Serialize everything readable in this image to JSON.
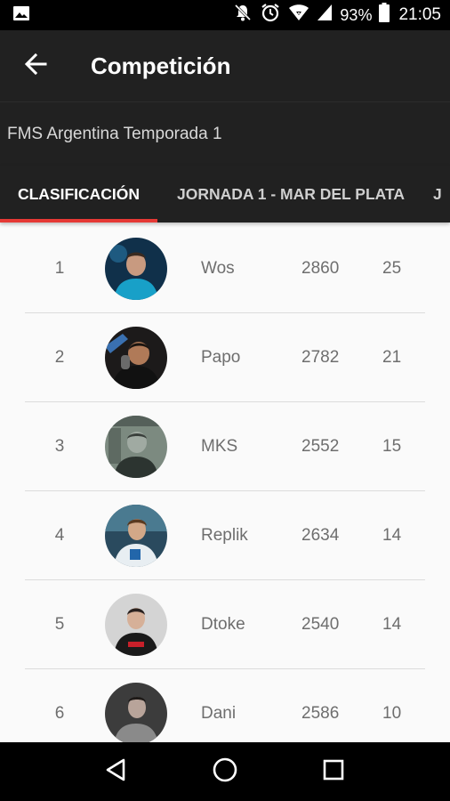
{
  "status_bar": {
    "battery": "93%",
    "time": "21:05",
    "icons": [
      "image-icon",
      "notifications-off-icon",
      "alarm-icon",
      "wifi-icon",
      "cellular-signal-icon",
      "battery-icon"
    ]
  },
  "app_bar": {
    "title": "Competición",
    "back_icon": "arrow-back-icon"
  },
  "competition": {
    "name": "FMS Argentina Temporada 1"
  },
  "tabs": [
    {
      "label": "CLASIFICACIÓN",
      "active": true
    },
    {
      "label": "JORNADA 1 - MAR DEL PLATA",
      "active": false
    },
    {
      "label": "J",
      "active": false
    }
  ],
  "accent_color": "#e53935",
  "standings": [
    {
      "position": "1",
      "name": "Wos",
      "points": "2860",
      "wins": "25"
    },
    {
      "position": "2",
      "name": "Papo",
      "points": "2782",
      "wins": "21"
    },
    {
      "position": "3",
      "name": "MKS",
      "points": "2552",
      "wins": "15"
    },
    {
      "position": "4",
      "name": "Replik",
      "points": "2634",
      "wins": "14"
    },
    {
      "position": "5",
      "name": "Dtoke",
      "points": "2540",
      "wins": "14"
    },
    {
      "position": "6",
      "name": "Dani",
      "points": "2586",
      "wins": "10"
    }
  ],
  "nav_bar": {
    "icons": [
      "back-triangle-icon",
      "home-circle-icon",
      "recents-square-icon"
    ]
  }
}
